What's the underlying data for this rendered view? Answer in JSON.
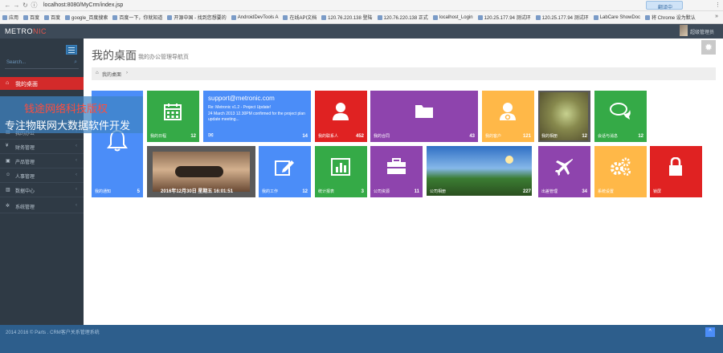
{
  "browser": {
    "url": "localhost:8080/MyCrm/index.jsp",
    "extension_label": "翻译中",
    "bookmarks": [
      "应用",
      "百度",
      "百度",
      "google_百度搜索",
      "百度一下，你就知道",
      "开源中国 - 找到您想要的",
      "AndroidDevTools A",
      "在线API文档",
      "120.76.220.138 登陆",
      "120.76.220.138 正式",
      "localhost_Login",
      "120.25.177.94 测试环",
      "120.25.177.94 测试环",
      "LabCare ShowDoc",
      "将 Chrome 设为默认"
    ],
    "more": "»"
  },
  "header": {
    "logo_main": "METRO",
    "logo_accent": "NIC",
    "user_name": "超级管理员"
  },
  "sidebar": {
    "search_placeholder": "Search...",
    "search_icon": "magnifier-icon",
    "active_item": {
      "icon": "home-icon",
      "label": "我的桌面"
    },
    "items": [
      {
        "label": "我的办公",
        "icon": "doc-icon"
      },
      {
        "label": "财务管理",
        "icon": "money-icon"
      },
      {
        "label": "产品管理",
        "icon": "box-icon"
      },
      {
        "label": "人事管理",
        "icon": "people-icon"
      },
      {
        "label": "数据中心",
        "icon": "chart-icon"
      },
      {
        "label": "系统管理",
        "icon": "gear-icon"
      }
    ]
  },
  "watermark": {
    "line1": "钱途网络科技版权",
    "line2": "专注物联网大数据软件开发"
  },
  "page": {
    "title": "我的桌面",
    "subtitle": "我的办公管理导航页",
    "breadcrumb_home": "我的桌面",
    "breadcrumb_sep": "›"
  },
  "tiles": {
    "notice": {
      "label": "我的通知",
      "count": "5"
    },
    "calendar": {
      "label": "我的日程",
      "count": "12"
    },
    "mail": {
      "from": "support@metronic.com",
      "subject": "Re: Metronic v1.2 - Project Update!",
      "body": "24 March 2013 12.30PM confirmed for the project plan update meeting...",
      "count": "14"
    },
    "contacts": {
      "label": "我的联系人",
      "count": "452"
    },
    "docs": {
      "label": "我的合同",
      "count": "43"
    },
    "customers": {
      "label": "我的客户",
      "count": "121"
    },
    "photo_fly": {
      "label": "我的相册",
      "count": "12"
    },
    "chat": {
      "label": "会话与消息",
      "count": "12"
    },
    "date": {
      "label": "2016年12月30日 星期五 16:01:51"
    },
    "write": {
      "label": "我的工作",
      "count": "12"
    },
    "report": {
      "label": "统计报表",
      "count": "3"
    },
    "office": {
      "label": "公司资源",
      "count": "11"
    },
    "landscape": {
      "label": "公司相册",
      "count": "227"
    },
    "travel": {
      "label": "出差管理",
      "count": "34"
    },
    "settings": {
      "label": "系统设置"
    },
    "lock": {
      "label": "锁屏"
    }
  },
  "footer": {
    "copyright": "2014 2016 © Parts . CRM客户关系管理系统",
    "top_icon": "arrow-up-icon"
  },
  "colors": {
    "blue": "#4b8df8",
    "green": "#35aa47",
    "red": "#e02222",
    "purple": "#8e44ad",
    "orange": "#ffb848",
    "sidebar": "#2f3a45",
    "header": "#3d4a58",
    "footer": "#2d5e8c"
  }
}
